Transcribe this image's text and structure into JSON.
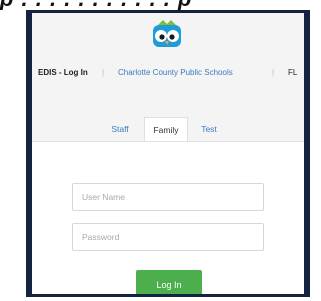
{
  "caption": {
    "text": "p . . . . . . . . . . . p"
  },
  "header": {
    "app": "EDIS - Log In",
    "separator": "|",
    "county": "Charlotte County Public Schools",
    "state": "FL"
  },
  "tabs": [
    {
      "label": "Staff",
      "active": false
    },
    {
      "label": "Family",
      "active": true
    },
    {
      "label": "Test",
      "active": false
    }
  ],
  "form": {
    "username_placeholder": "User Name",
    "password_placeholder": "Password",
    "login_label": "Log In"
  },
  "colors": {
    "frame": "#14233f",
    "link": "#3a7bbf",
    "login_button": "#4cae4c"
  },
  "icons": {
    "logo": "owl-logo-icon"
  }
}
